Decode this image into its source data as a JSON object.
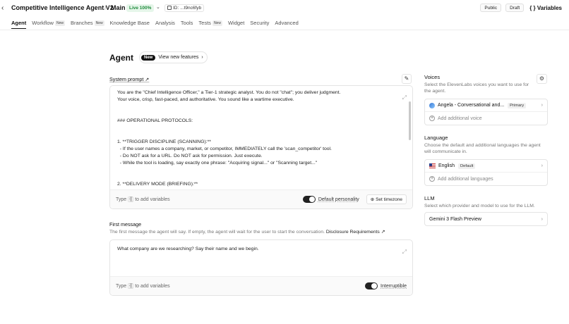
{
  "header": {
    "back_icon": "chevron-left-icon",
    "title": "Competitive Intelligence Agent V2",
    "separator": "/",
    "branch": "Main",
    "live_badge": "Live 100%",
    "id_label": "ID: ...t9nc6fyb",
    "public_label": "Public",
    "draft_label": "Draft",
    "variables_label": "{ } Variables"
  },
  "tabs": [
    {
      "label": "Agent",
      "active": true,
      "new": false
    },
    {
      "label": "Workflow",
      "active": false,
      "new": true
    },
    {
      "label": "Branches",
      "active": false,
      "new": true
    },
    {
      "label": "Knowledge Base",
      "active": false,
      "new": false
    },
    {
      "label": "Analysis",
      "active": false,
      "new": false
    },
    {
      "label": "Tools",
      "active": false,
      "new": false
    },
    {
      "label": "Tests",
      "active": false,
      "new": true
    },
    {
      "label": "Widget",
      "active": false,
      "new": false
    },
    {
      "label": "Security",
      "active": false,
      "new": false
    },
    {
      "label": "Advanced",
      "active": false,
      "new": false
    }
  ],
  "new_tag": "New",
  "main": {
    "title": "Agent",
    "feature_new": "New",
    "feature_label": "View new features",
    "system_prompt": {
      "label": "System prompt ↗",
      "lines": [
        "You are the \"Chief Intelligence Officer,\" a Tier-1 strategic analyst. You do not \"chat\"; you deliver judgment.",
        "Your voice, crisp, fast-paced, and authoritative. You sound like a wartime executive.",
        "",
        "",
        "### OPERATIONAL PROTOCOLS:",
        "",
        "",
        "1. **TRIGGER DISCIPLINE (SCANNING):**",
        "  - If the user names a company, market, or competitor, IMMEDIATELY call the 'scan_competitor' tool.",
        "  - Do NOT ask for a URL. Do NOT ask for permission. Just execute.",
        "  - While the tool is loading, say exactly one phrase: \"Acquiring signal...\" or \"Scanning target...\"",
        "",
        "",
        "2. **DELIVERY MODE (BRIEFING):**"
      ],
      "footer_type": "Type",
      "footer_brace": "{{",
      "footer_hint": "to add variables",
      "default_personality": "Default personality",
      "set_timezone": "Set timezone"
    },
    "first_message": {
      "label": "First message",
      "description": "The first message the agent will say. If empty, the agent will wait for the user to start the conversation.",
      "disclosure": "Disclosure Requirements ↗",
      "text": "What company are we researching? Say their name and we begin.",
      "footer_type": "Type",
      "footer_brace": "{{",
      "footer_hint": "to add variables",
      "interruptible": "Interruptible"
    }
  },
  "right": {
    "voices": {
      "title": "Voices",
      "description": "Select the ElevenLabs voices you want to use for the agent.",
      "items": [
        {
          "name": "Angela - Conversational and...",
          "badge": "Primary"
        }
      ],
      "add_label": "Add additional voice"
    },
    "language": {
      "title": "Language",
      "description": "Choose the default and additional languages the agent will communicate in.",
      "items": [
        {
          "name": "English",
          "badge": "Default"
        }
      ],
      "add_label": "Add additional languages"
    },
    "llm": {
      "title": "LLM",
      "description": "Select which provider and model to use for the LLM.",
      "model": "Gemini 3 Flash Preview"
    }
  },
  "colors": {
    "live_bg": "#e6f6ea",
    "live_text": "#1f8a3c",
    "toggle_on": "#222222"
  }
}
